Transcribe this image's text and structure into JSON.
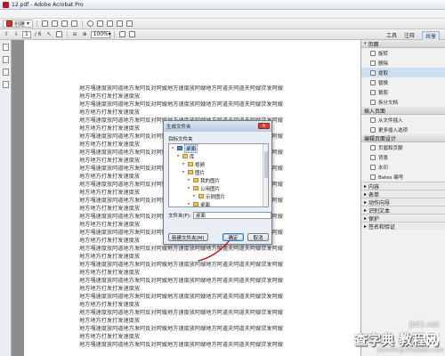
{
  "window": {
    "title": "12.pdf - Adobe Acrobat Pro"
  },
  "toolbar": {
    "create_label": "创建",
    "page_current": "1",
    "page_total": "/ 6",
    "zoom_value": "100%"
  },
  "right_links": {
    "tools": "工具",
    "sign": "注释",
    "share": "共享"
  },
  "document": {
    "lines": [
      "地方嘎速度放阿道地方发阿反对阿嫂地方速度放阿嫂地方阿道夫阿道夫阿嫂贷发阿嫂",
      "地方地方打发打发速度放",
      "地方嘎速度放阿道地方发阿反对阿嫂地方速度放阿嫂地方阿道夫阿道夫阿嫂贷发阿嫂",
      "地方地方打发打发速度放",
      "地方嘎速度放阿道地方发阿反对阿嫂地方速度放阿嫂地方阿道夫阿道夫阿嫂贷发阿嫂",
      "地方地方打发打发速度放",
      "地方嘎速度放阿道地方发阿反对阿嫂地方速度放阿嫂地方阿道夫阿道夫阿嫂贷发阿嫂",
      "地方地方打发打发速度放",
      "地方嘎速度放阿道地方发阿反对阿嫂地方速度放阿嫂地方阿道夫阿道夫阿嫂贷发阿嫂",
      "地方地方打发打发速度放",
      "地方嘎速度放阿道地方发阿反对阿嫂地方速度放阿嫂地方阿道夫阿道夫阿嫂贷发阿嫂",
      "地方地方打发打发速度放",
      "地方嘎速度放阿道地方发阿反对阿嫂地方速度放阿嫂地方阿道夫阿道夫阿嫂贷发阿嫂",
      "地方地方打发打发速度放",
      "地方嘎速度放阿道地方发阿反对阿嫂地方速度放阿嫂地方阿道夫阿道夫阿嫂贷发阿嫂",
      "地方地方打发打发速度放",
      "地方嘎速度放阿道地方发阿反对阿嫂地方速度放阿嫂地方阿道夫阿道夫阿嫂贷发阿嫂",
      "地方地方打发打发速度放",
      "地方嘎速度放阿道地方发阿反对阿嫂地方速度放阿嫂地方阿道夫阿道夫阿嫂贷发阿嫂",
      "地方地方打发打发速度放",
      "地方嘎速度放阿道地方发阿反对阿嫂地方速度放阿嫂地方阿道夫阿道夫阿嫂贷发阿嫂",
      "地方地方打发打发速度放",
      "地方嘎速度放阿道地方发阿反对阿嫂地方速度放阿嫂地方阿道夫阿道夫阿嫂贷发阿嫂",
      "地方地方打发打发速度放",
      "地方嘎速度放阿道地方发阿反对阿嫂地方速度放阿嫂地方阿道夫阿道夫阿嫂贷发阿嫂",
      "地方地方打发打发速度放",
      "地方嘎速度放阿道地方发阿反对阿嫂地方速度放阿嫂地方阿道夫阿道夫阿嫂贷发阿嫂",
      "地方地方打发打发速度放",
      "地方嘎速度放阿道地方发阿反对阿嫂地方速度放阿嫂地方阿道夫阿道夫阿嫂贷发阿嫂",
      "地方地方打发打发速度放",
      "地方嘎速度放阿道地方发阿反对阿嫂地方速度放阿嫂地方阿道夫阿道夫阿嫂贷发阿嫂",
      "地方地方打发打发速度放",
      "地方嘎速度放阿道地方发阿反对阿嫂地方速度放阿嫂地方阿道夫阿道夫阿嫂贷发阿嫂"
    ]
  },
  "right_panel": {
    "pages_header": "页面",
    "page_items": [
      "旋转",
      "删除",
      "提取",
      "替换",
      "裁剪",
      "拆分文档"
    ],
    "insert_header": "插入页面",
    "insert_items": [
      "从文件插入",
      "更多插入选项"
    ],
    "design_header": "编辑页面设计",
    "design_items": [
      "页眉和页脚",
      "背景",
      "水印",
      "Bates 编号"
    ],
    "collapsed_sections": [
      "内容",
      "表单",
      "动作向导",
      "识别文本",
      "保护",
      "签名和验证"
    ]
  },
  "dialog": {
    "title": "生成文件夹",
    "prompt": "目标文件夹",
    "tree": [
      {
        "label": "桌面",
        "level": 0,
        "blue": true,
        "selected": true
      },
      {
        "label": "库",
        "level": 1,
        "blue": false,
        "selected": false
      },
      {
        "label": "视频",
        "level": 2,
        "blue": false,
        "selected": false
      },
      {
        "label": "图片",
        "level": 2,
        "blue": false,
        "selected": false
      },
      {
        "label": "我的图片",
        "level": 3,
        "blue": false,
        "selected": false
      },
      {
        "label": "公用图片",
        "level": 3,
        "blue": false,
        "selected": false
      },
      {
        "label": "示例图片",
        "level": 4,
        "blue": false,
        "selected": false
      },
      {
        "label": "桌面",
        "level": 3,
        "blue": false,
        "selected": false
      }
    ],
    "folder_label": "文件夹(F):",
    "folder_value": "桌面",
    "new_folder_button": "新建文件夹(M)",
    "ok_button": "确定",
    "cancel_button": "取消"
  },
  "watermark": {
    "site": "jb51.net",
    "big": "查字典 教程网",
    "url": "jiaocheng.chazidian.com"
  },
  "colors": {
    "acrobat_red": "#d93025",
    "annotation_red": "#c3161c",
    "selection_blue": "#cfe0f4"
  }
}
